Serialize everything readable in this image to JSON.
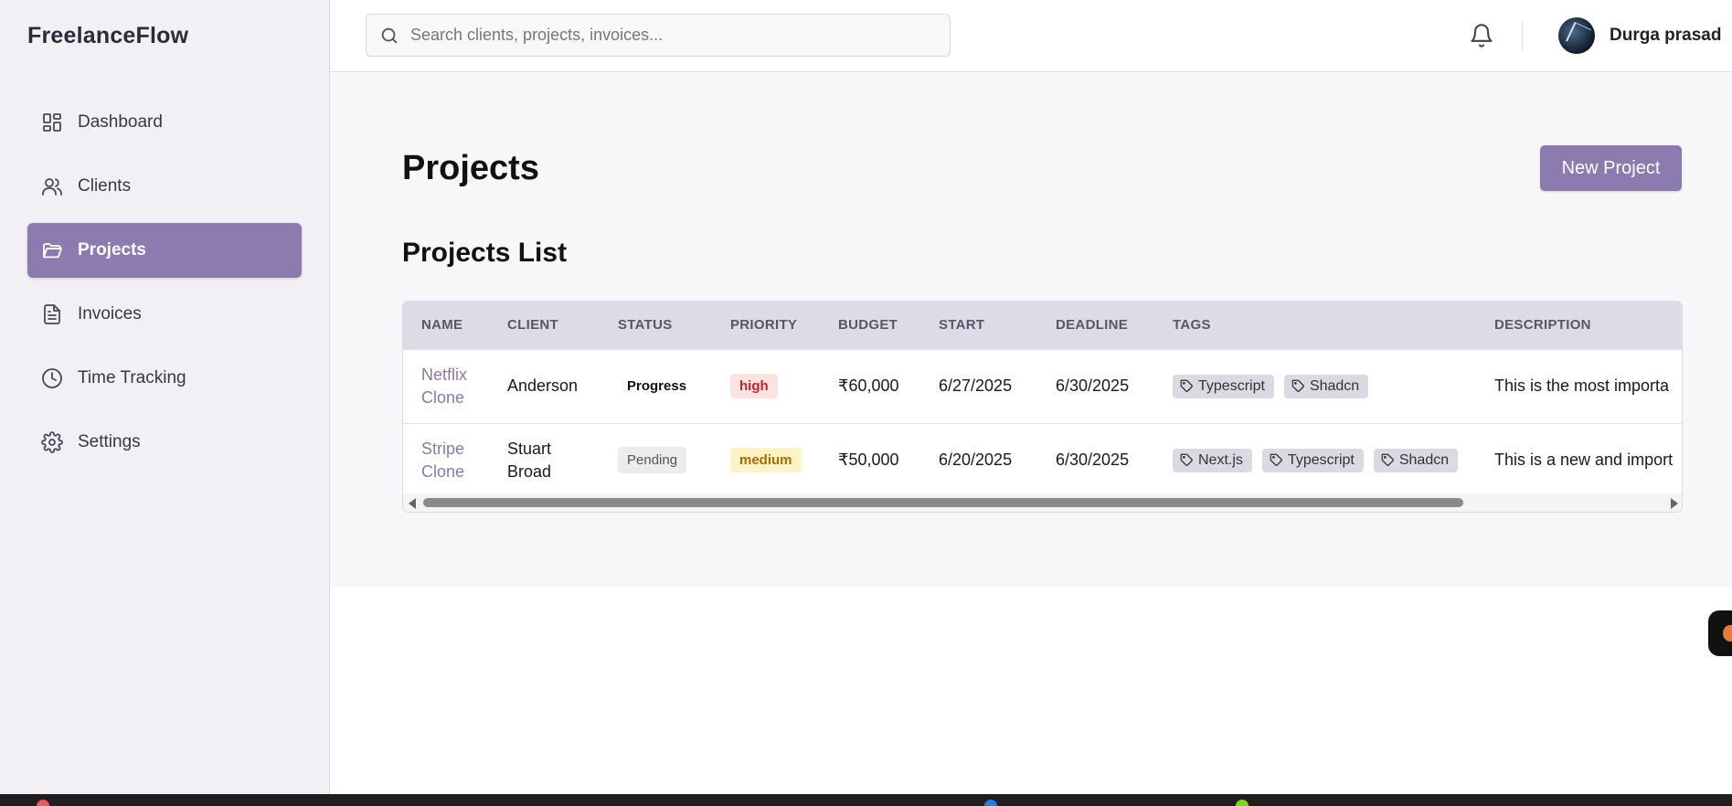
{
  "brand": "FreelanceFlow",
  "sidebar": {
    "items": [
      {
        "label": "Dashboard",
        "icon": "dashboard-icon"
      },
      {
        "label": "Clients",
        "icon": "users-icon"
      },
      {
        "label": "Projects",
        "icon": "folder-icon",
        "active": true
      },
      {
        "label": "Invoices",
        "icon": "document-icon"
      },
      {
        "label": "Time Tracking",
        "icon": "clock-icon"
      },
      {
        "label": "Settings",
        "icon": "gear-icon"
      }
    ]
  },
  "header": {
    "search_placeholder": "Search clients, projects, invoices...",
    "user_name": "Durga prasad"
  },
  "main": {
    "title": "Projects",
    "new_button": "New Project",
    "section_title": "Projects List",
    "table": {
      "columns": [
        "NAME",
        "CLIENT",
        "STATUS",
        "PRIORITY",
        "BUDGET",
        "START",
        "DEADLINE",
        "TAGS",
        "DESCRIPTION"
      ],
      "rows": [
        {
          "name_line1": "Netflix",
          "name_line2": "Clone",
          "client_line1": "Anderson",
          "client_line2": "",
          "status": "Progress",
          "priority": "high",
          "budget": "₹60,000",
          "start": "6/27/2025",
          "deadline": "6/30/2025",
          "tags": [
            "Typescript",
            "Shadcn"
          ],
          "description": "This is the most importa"
        },
        {
          "name_line1": "Stripe",
          "name_line2": "Clone",
          "client_line1": "Stuart",
          "client_line2": "Broad",
          "status": "Pending",
          "priority": "medium",
          "budget": "₹50,000",
          "start": "6/20/2025",
          "deadline": "6/30/2025",
          "tags": [
            "Next.js",
            "Typescript",
            "Shadcn"
          ],
          "description": "This is a new and import"
        }
      ]
    }
  },
  "colors": {
    "accent": "#8c7bae",
    "sidebar_bg": "#f2f0f5",
    "priority_high": "#c0262d",
    "priority_medium": "#a66b00"
  }
}
